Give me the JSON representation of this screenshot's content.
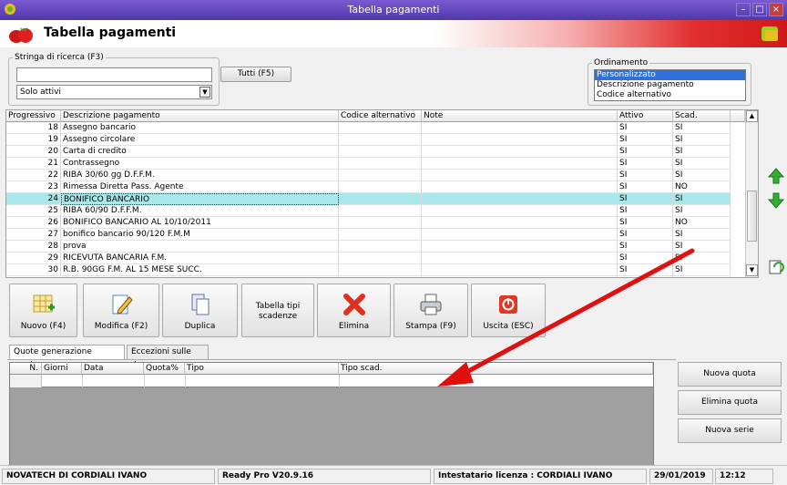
{
  "window": {
    "title": "Tabella pagamenti"
  },
  "header": {
    "title": "Tabella pagamenti"
  },
  "search": {
    "legend": "Stringa di ricerca (F3)",
    "value": "",
    "all_button": "Tutti (F5)",
    "filter_value": "Solo attivi"
  },
  "ordering": {
    "legend": "Ordinamento",
    "options": [
      "Personalizzato",
      "Descrizione pagamento",
      "Codice alternativo"
    ],
    "selected": "Personalizzato"
  },
  "grid": {
    "headers": [
      "Progressivo",
      "Descrizione pagamento",
      "Codice alternativo",
      "Note",
      "Attivo",
      "Scad."
    ],
    "rows": [
      [
        "18",
        "Assegno bancario",
        "",
        "",
        "SI",
        "SI"
      ],
      [
        "19",
        "Assegno circolare",
        "",
        "",
        "SI",
        "SI"
      ],
      [
        "20",
        "Carta di credito",
        "",
        "",
        "SI",
        "SI"
      ],
      [
        "21",
        "Contrassegno",
        "",
        "",
        "SI",
        "SI"
      ],
      [
        "22",
        "RIBA 30/60 gg D.F.F.M.",
        "",
        "",
        "SI",
        "SI"
      ],
      [
        "23",
        "Rimessa Diretta Pass. Agente",
        "",
        "",
        "SI",
        "NO"
      ],
      [
        "24",
        "BONIFICO BANCARIO",
        "",
        "",
        "SI",
        "SI"
      ],
      [
        "25",
        "RIBA 60/90 D.F.F.M.",
        "",
        "",
        "SI",
        "SI"
      ],
      [
        "26",
        "BONIFICO BANCARIO AL 10/10/2011",
        "",
        "",
        "SI",
        "NO"
      ],
      [
        "27",
        "bonifico bancario 90/120 F.M.M",
        "",
        "",
        "SI",
        "SI"
      ],
      [
        "28",
        "prova",
        "",
        "",
        "SI",
        "SI"
      ],
      [
        "29",
        "RICEVUTA BANCARIA F.M.",
        "",
        "",
        "SI",
        "SI"
      ],
      [
        "30",
        "R.B. 90GG F.M. AL 15 MESE SUCC.",
        "",
        "",
        "SI",
        "SI"
      ]
    ],
    "selected_index": 6
  },
  "toolbar": {
    "new": "Nuovo (F4)",
    "edit": "Modifica (F2)",
    "duplicate": "Duplica",
    "types_line1": "Tabella tipi",
    "types_line2": "scadenze",
    "delete": "Elimina",
    "print": "Stampa (F9)",
    "exit": "Uscita (ESC)"
  },
  "tabs": [
    "Quote generazione scadenze",
    "Eccezioni sulle date"
  ],
  "quote_grid": {
    "headers": [
      "N.",
      "Giorni",
      "Data",
      "Quota%",
      "Tipo",
      "Tipo scad."
    ]
  },
  "side_buttons": {
    "new_quota": "Nuova quota",
    "delete_quota": "Elimina quota",
    "new_series": "Nuova serie"
  },
  "status": {
    "company": "NOVATECH DI CORDIALI IVANO",
    "version": "Ready Pro V20.9.16",
    "license": "Intestatario licenza : CORDIALI IVANO",
    "date": "29/01/2019",
    "time": "12:12"
  },
  "colors": {
    "title_bar": "#5a40b8",
    "selection": "#a8e8ea",
    "header_red": "#d01818",
    "annotation_arrow": "#e01010"
  }
}
